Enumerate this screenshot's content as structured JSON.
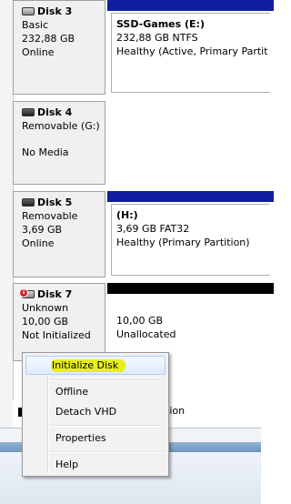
{
  "disks": [
    {
      "name": "Disk 3",
      "type": "Basic",
      "size": "232,88 GB",
      "status": "Online",
      "partition": {
        "name": "SSD-Games  (E:)",
        "size": "232,88 GB NTFS",
        "status": "Healthy (Active, Primary Partit"
      }
    },
    {
      "name": "Disk 4",
      "type": "Removable (G:)",
      "status": "No Media"
    },
    {
      "name": "Disk 5",
      "type": "Removable",
      "size": "3,69 GB",
      "status": "Online",
      "partition": {
        "name": " (H:)",
        "size": "3,69 GB FAT32",
        "status": "Healthy (Primary Partition)"
      }
    },
    {
      "name": "Disk 7",
      "type": "Unknown",
      "size": "10,00 GB",
      "status": "Not Initialized",
      "partition": {
        "size": "10,00 GB",
        "status": "Unallocated"
      }
    }
  ],
  "legend": {
    "partial_text": "ition"
  },
  "context_menu": {
    "items": [
      {
        "label": "Initialize Disk",
        "highlighted": true
      },
      {
        "label": "Offline"
      },
      {
        "label": "Detach VHD"
      },
      {
        "label": "Properties"
      },
      {
        "label": "Help"
      }
    ]
  },
  "colors": {
    "partition_bar_primary": "#0f1fa0",
    "partition_bar_unallocated": "#000000",
    "highlight_marker": "#e8ee1c"
  },
  "icons": {
    "fixed_disk": "hard-disk-icon",
    "removable_disk": "removable-disk-icon",
    "uninitialized_disk": "disk-error-icon"
  }
}
